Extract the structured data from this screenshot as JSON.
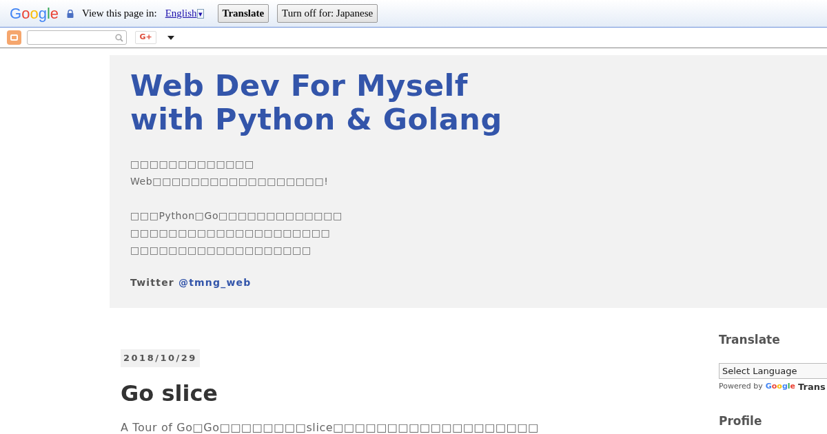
{
  "translate_bar": {
    "logo": "Google",
    "prompt": "View this page in:",
    "language": "English",
    "dropdown_arrow": "▾",
    "buttons": [
      "Translate",
      "Turn off for: Japanese"
    ]
  },
  "navbar": {
    "gplus": "G+"
  },
  "header": {
    "title_lines": [
      "Web Dev For Myself",
      "with Python & Golang"
    ],
    "description": [
      [
        "□□□□□□□□□□□□□",
        "Web□□□□□□□□□□□□□□□□□□!"
      ],
      [
        "□□□Python□Go□□□□□□□□□□□□□",
        "□□□□□□□□□□□□□□□□□□□□□",
        "□□□□□□□□□□□□□□□□□□□"
      ]
    ],
    "twitter_label": "Twitter",
    "twitter_handle": "@tmng_web"
  },
  "post": {
    "date": "2018/10/29",
    "title": "Go slice",
    "excerpt": "A Tour of Go□Go□□□□□□□□slice□□□□□□□□□□□□□□□□□□□"
  },
  "sidebar": {
    "translate_heading": "Translate",
    "select": "Select Language",
    "powered_by": "Powered by",
    "google": "Google",
    "trans": "Trans",
    "profile_heading": "Profile"
  }
}
